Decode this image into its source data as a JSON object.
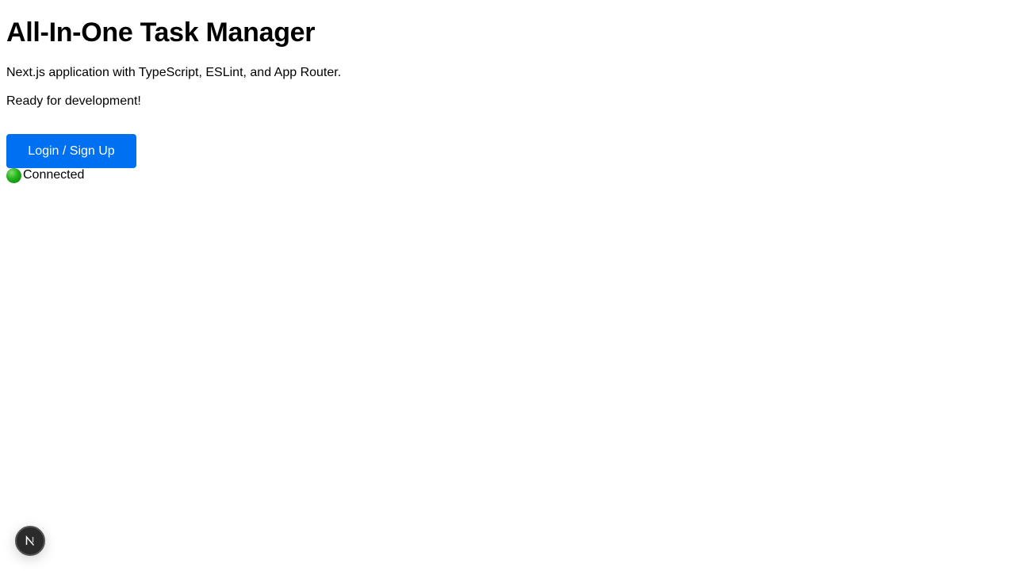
{
  "page": {
    "title": "All-In-One Task Manager",
    "description": "Next.js application with TypeScript, ESLint, and App Router.",
    "status_message": "Ready for development!"
  },
  "auth": {
    "login_label": "Login / Sign Up"
  },
  "connection": {
    "label": "Connected",
    "indicator_color": "#21b21a",
    "indicator_icon": "green-circle"
  },
  "dev_tools": {
    "badge_letter": "N",
    "icon": "nextjs-logo"
  },
  "colors": {
    "primary_button": "#0070f3"
  }
}
